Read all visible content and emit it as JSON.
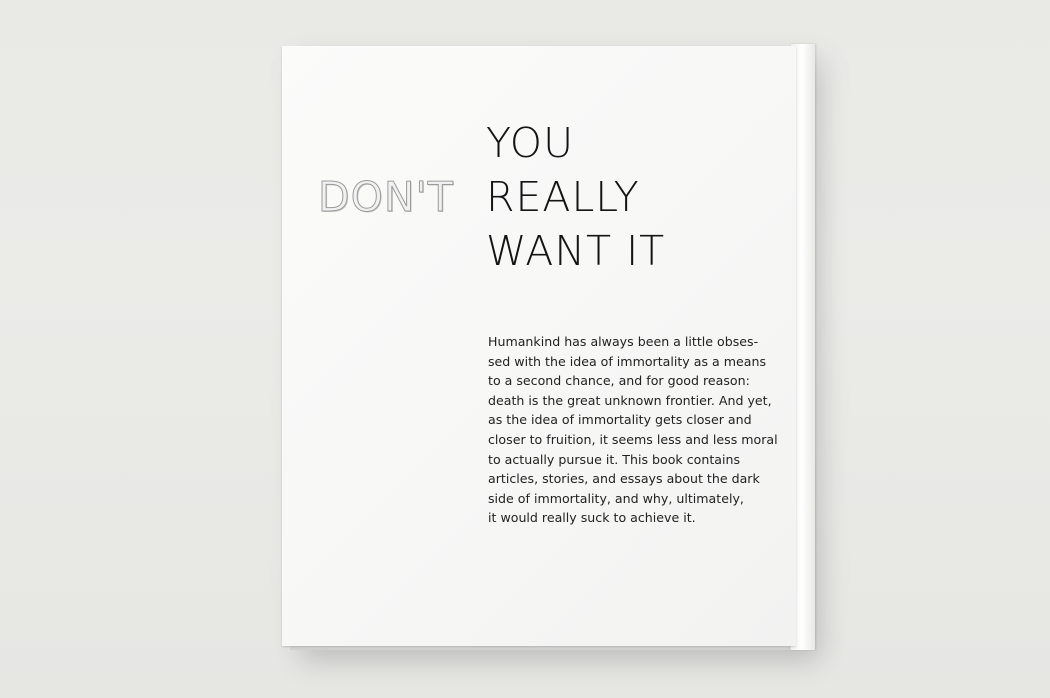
{
  "cover": {
    "cutout_word": "DON'T",
    "title_lines": [
      "YOU",
      "REALLY",
      "WANT IT"
    ],
    "blurb_lines": [
      "Humankind has always been a little obses-",
      "sed with the idea of immortality as a means",
      "to a second chance, and for good reason:",
      "death is the great unknown frontier. And yet,",
      "as the idea of immortality gets closer and",
      "closer to fruition, it seems less and less moral",
      "to actually pursue it. This book contains",
      "articles, stories, and essays about the dark",
      "side of immortality, and why, ultimately,",
      "it would really suck to achieve it."
    ]
  },
  "colors": {
    "background": "#e9e9e6",
    "cover": "#f8f8f7",
    "text": "#141414"
  }
}
